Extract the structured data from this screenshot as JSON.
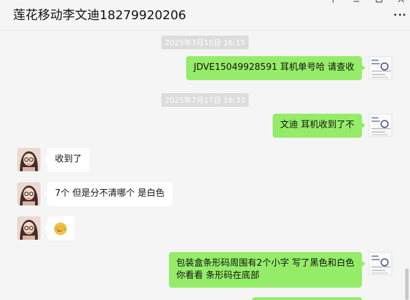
{
  "window": {
    "title": "莲花移动李文迪18279920206"
  },
  "messages": [
    {
      "type": "time",
      "text": "2025年7月15日 16:15"
    },
    {
      "type": "sent",
      "text": "JDVE15049928591  耳机单号哈 请查收"
    },
    {
      "type": "time",
      "text": "2025年7月17日 16:33"
    },
    {
      "type": "sent",
      "text": "文迪 耳机收到了不"
    },
    {
      "type": "received",
      "text": "收到了"
    },
    {
      "type": "received",
      "text": "7个 但是分不清哪个 是白色"
    },
    {
      "type": "received",
      "emoji": "facepalm-emoji"
    },
    {
      "type": "sent",
      "line1": "包装盒条形码周围有2个小字  写了黑色和白色",
      "line2": "你看看 条形码在底部"
    }
  ],
  "colors": {
    "sent_bubble": "#95ec69",
    "received_bubble": "#ffffff",
    "background": "#f5f5f5",
    "time_badge": "#dcdcdc"
  },
  "icons": [
    "pin-icon",
    "minimize-icon",
    "maximize-icon",
    "close-icon",
    "more-icon"
  ]
}
